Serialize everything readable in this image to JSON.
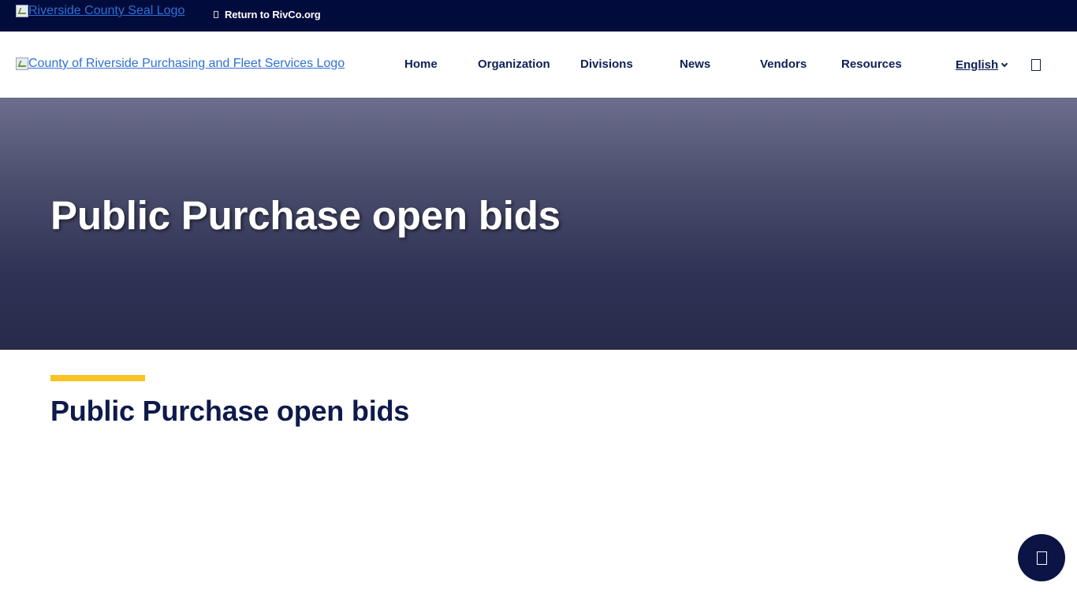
{
  "topbar": {
    "seal_logo_alt": "Riverside County Seal Logo",
    "return_link": "Return to RivCo.org"
  },
  "header": {
    "logo_alt": "County of Riverside Purchasing and Fleet Services Logo",
    "nav": [
      {
        "label": "Home"
      },
      {
        "label": "Organization"
      },
      {
        "label": "Divisions"
      },
      {
        "label": "News"
      },
      {
        "label": "Vendors"
      },
      {
        "label": "Resources"
      }
    ],
    "language": "English"
  },
  "hero": {
    "title": "Public Purchase open bids"
  },
  "content": {
    "heading": "Public Purchase open bids"
  },
  "colors": {
    "topbar_bg": "#020c3c",
    "nav_text": "#0e2056",
    "accent": "#f7c325",
    "link": "#2f6fd6",
    "chat_button": "#0b1444"
  },
  "icons": {
    "external_link": "external-link-icon",
    "language_dropdown": "chevron-down-icon",
    "search": "search-icon",
    "chat": "chat-icon"
  }
}
